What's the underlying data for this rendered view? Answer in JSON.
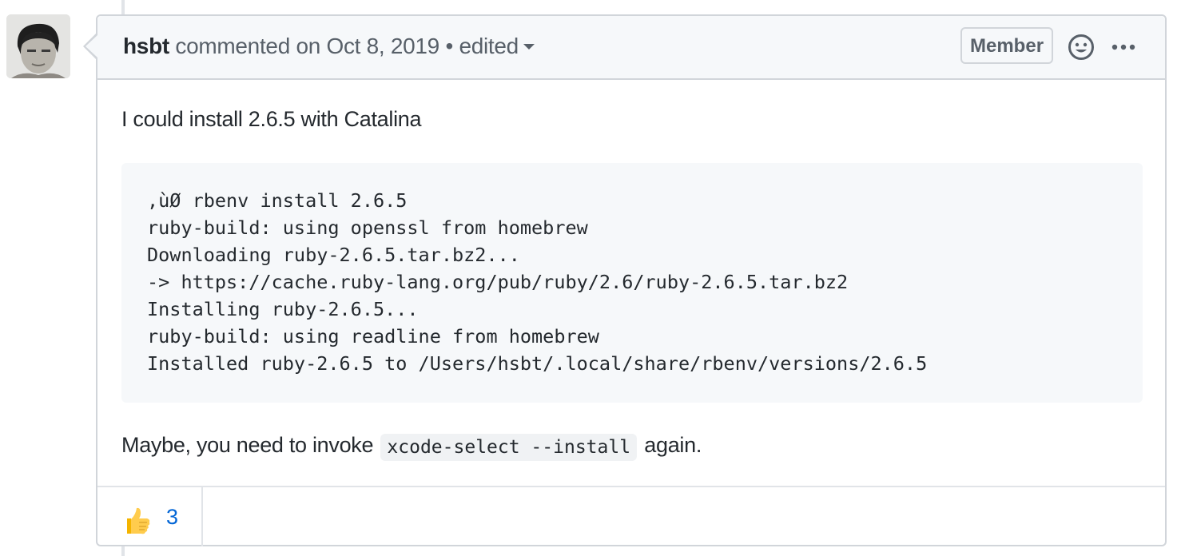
{
  "comment": {
    "author": "hsbt",
    "action": "commented on",
    "date": "Oct 8, 2019",
    "separator": "•",
    "edited_label": "edited",
    "badge": "Member",
    "body_intro": "I could install 2.6.5 with Catalina",
    "code_lines": [
      ",ùØ rbenv install 2.6.5",
      "ruby-build: using openssl from homebrew",
      "Downloading ruby-2.6.5.tar.bz2...",
      "-> https://cache.ruby-lang.org/pub/ruby/2.6/ruby-2.6.5.tar.bz2",
      "Installing ruby-2.6.5...",
      "ruby-build: using readline from homebrew",
      "Installed ruby-2.6.5 to /Users/hsbt/.local/share/rbenv/versions/2.6.5"
    ],
    "footer_before": "Maybe, you need to invoke",
    "footer_code": "xcode-select --install",
    "footer_after": "again.",
    "reactions": [
      {
        "icon": "thumbs-up-icon",
        "count": "3"
      }
    ]
  },
  "colors": {
    "link": "#0366d6",
    "border": "#d1d5da",
    "header_bg": "#f6f8fa",
    "text": "#24292e",
    "muted": "#586069"
  }
}
